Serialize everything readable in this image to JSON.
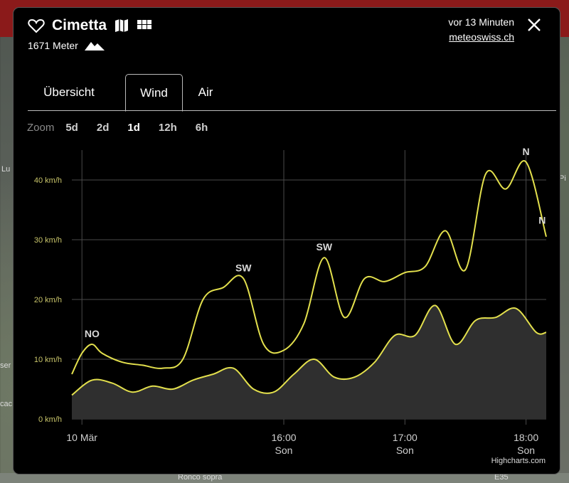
{
  "station": {
    "name": "Cimetta",
    "altitude": "1671 Meter"
  },
  "meta": {
    "updated": "vor 13 Minuten",
    "source": "meteoswiss.ch"
  },
  "icons": {
    "favorite": "heart-icon",
    "map": "map-icon",
    "grid": "grid-icon",
    "altitude": "mountain-icon",
    "close": "close-icon"
  },
  "tabs": [
    {
      "label": "Übersicht",
      "active": false
    },
    {
      "label": "Wind",
      "active": true
    },
    {
      "label": "Air",
      "active": false
    }
  ],
  "zoom": {
    "label": "Zoom",
    "options": [
      "5d",
      "2d",
      "1d",
      "12h",
      "6h"
    ],
    "selected": "1d"
  },
  "map_labels": [
    "Lu",
    "ser",
    "cac",
    "Pi",
    "Ronco sopra",
    "E35"
  ],
  "credit": "Highcharts.com",
  "colors": {
    "line": "#e3e04d",
    "area": "#2f2f2f",
    "grid": "#4a4a4a",
    "axisLabel": "#c8c46a"
  },
  "chart_data": {
    "type": "area",
    "title": "",
    "xlabel": "",
    "ylabel": "",
    "ylim": [
      0,
      45
    ],
    "y_ticks": [
      0,
      10,
      20,
      30,
      40
    ],
    "y_tick_labels": [
      "0 km/h",
      "10 km/h",
      "20 km/h",
      "30 km/h",
      "40 km/h"
    ],
    "x_range": [
      "2020-03-10 14:15",
      "2020-03-10 18:10"
    ],
    "x_ticks": [
      {
        "x": "2020-03-10 14:20",
        "label": "10 Mär",
        "sublabel": ""
      },
      {
        "x": "2020-03-10 16:00",
        "label": "16:00",
        "sublabel": "Son"
      },
      {
        "x": "2020-03-10 17:00",
        "label": "17:00",
        "sublabel": "Son"
      },
      {
        "x": "2020-03-10 18:00",
        "label": "18:00",
        "sublabel": "Son"
      }
    ],
    "grid": true,
    "series": [
      {
        "type": "line",
        "x": [
          "14:15",
          "14:20",
          "14:25",
          "14:30",
          "14:40",
          "14:50",
          "15:00",
          "15:10",
          "15:20",
          "15:30",
          "15:40",
          "15:50",
          "16:00",
          "16:10",
          "16:20",
          "16:30",
          "16:40",
          "16:50",
          "17:00",
          "17:10",
          "17:20",
          "17:30",
          "17:40",
          "17:50",
          "18:00",
          "18:10"
        ],
        "values": [
          7.5,
          11,
          12.5,
          11,
          9.5,
          9,
          8.5,
          10,
          20,
          22,
          23.5,
          12.5,
          11.5,
          16,
          27,
          17,
          23.5,
          23,
          24.5,
          25.5,
          31.5,
          25,
          41,
          38.5,
          43,
          30.5
        ]
      },
      {
        "type": "area",
        "x": [
          "14:15",
          "14:25",
          "14:35",
          "14:45",
          "14:55",
          "15:05",
          "15:15",
          "15:25",
          "15:35",
          "15:45",
          "15:55",
          "16:05",
          "16:15",
          "16:25",
          "16:35",
          "16:45",
          "16:55",
          "17:05",
          "17:15",
          "17:25",
          "17:35",
          "17:45",
          "17:55",
          "18:05",
          "18:10"
        ],
        "values": [
          4,
          6.5,
          6,
          4.5,
          5.5,
          5,
          6.5,
          7.5,
          8.5,
          5,
          4.5,
          7.5,
          10,
          7,
          7,
          9.5,
          14,
          14,
          19,
          12.5,
          16.5,
          17,
          18.5,
          14.5,
          14.5
        ]
      }
    ],
    "annotations": [
      {
        "x": "14:25",
        "y": 12.5,
        "text": "NO"
      },
      {
        "x": "15:40",
        "y": 23.5,
        "text": "SW"
      },
      {
        "x": "16:20",
        "y": 27,
        "text": "SW"
      },
      {
        "x": "18:00",
        "y": 43,
        "text": "N"
      },
      {
        "x": "18:08",
        "y": 31.5,
        "text": "N"
      }
    ]
  }
}
